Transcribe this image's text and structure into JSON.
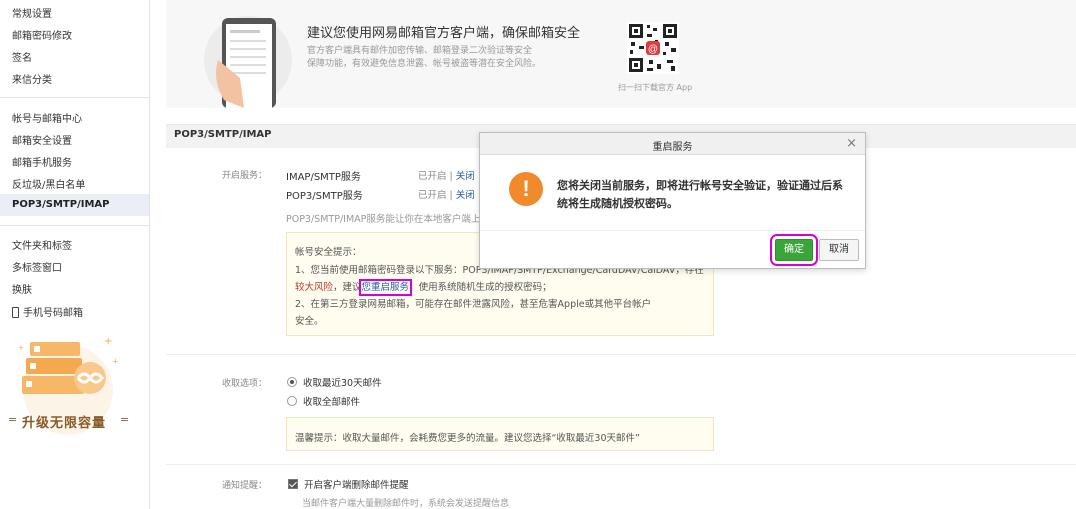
{
  "sidebar": {
    "items": [
      {
        "label": "常规设置"
      },
      {
        "label": "邮箱密码修改"
      },
      {
        "label": "签名"
      },
      {
        "label": "来信分类"
      },
      {
        "label": "帐号与邮箱中心"
      },
      {
        "label": "邮箱安全设置"
      },
      {
        "label": "邮箱手机服务"
      },
      {
        "label": "反垃圾/黑白名单"
      },
      {
        "label": "POP3/SMTP/IMAP"
      },
      {
        "label": "文件夹和标签"
      },
      {
        "label": "多标签窗口"
      },
      {
        "label": "换肤"
      },
      {
        "label": "手机号码邮箱"
      }
    ],
    "promo": {
      "text": "升级无限容量",
      "left_mark": "=",
      "right_mark": "="
    }
  },
  "banner": {
    "title": "建议您使用网易邮箱官方客户端，确保邮箱安全",
    "desc_line1": "官方客户端具有邮件加密传输、邮箱登录二次验证等安全",
    "desc_line2": "保障功能，有效避免信息泄露、帐号被盗等潜在安全风险。",
    "qr_caption": "扫一扫下载官方 App"
  },
  "section": {
    "title": "POP3/SMTP/IMAP"
  },
  "services": {
    "label": "开启服务：",
    "rows": [
      {
        "name": "IMAP/SMTP服务",
        "status": "已开启",
        "sep": "|",
        "action": "关闭"
      },
      {
        "name": "POP3/SMTP服务",
        "status": "已开启",
        "sep": "|",
        "action": "关闭"
      }
    ],
    "desc": "POP3/SMTP/IMAP服务能让你在本地客户端上"
  },
  "tip": {
    "title": "帐号安全提示：",
    "line1": "1、您当前使用邮箱密码登录以下服务：POP3/IMAP/SMTP/Exchange/CardDAV/CalDAV，存在",
    "line2_warn": "较大风险",
    "line2_pre": "，建议",
    "line2_link_a": "您",
    "line2_link": "重启服务",
    "line2_post": "，使用系统随机生成的授权密码；",
    "line3": "2、在第三方登录网易邮箱，可能存在邮件泄露风险，甚至危害Apple或其他平台帐户",
    "line4": "安全。"
  },
  "receive": {
    "label": "收取选项：",
    "opt1": "收取最近30天邮件",
    "opt2": "收取全部邮件",
    "hint": "温馨提示：收取大量邮件，会耗费您更多的流量。建议您选择“收取最近30天邮件”"
  },
  "notify": {
    "label": "通知提醒：",
    "check": "开启客户端删除邮件提醒",
    "note": "当邮件客户端大量删除邮件时，系统会发送提醒信息"
  },
  "modal": {
    "title": "重启服务",
    "close": "×",
    "icon": "!",
    "message": "您将关闭当前服务，即将进行帐号安全验证，验证通过后系统将生成随机授权密码。",
    "ok": "确定",
    "cancel": "取消"
  },
  "colors": {
    "accent_green": "#3aa53a",
    "warn_orange": "#f08a2b",
    "link_blue": "#2a5db0",
    "highlight": "#d400d4"
  }
}
